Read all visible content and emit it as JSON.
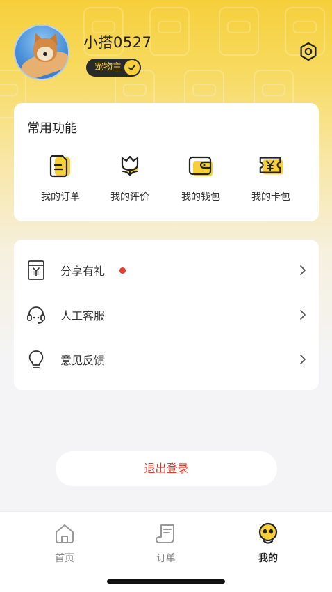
{
  "profile": {
    "username": "小搭0527",
    "badge": "宠物主"
  },
  "common_functions": {
    "title": "常用功能",
    "items": [
      {
        "label": "我的订单",
        "icon": "order-doc-icon"
      },
      {
        "label": "我的评价",
        "icon": "tulip-icon"
      },
      {
        "label": "我的钱包",
        "icon": "wallet-icon"
      },
      {
        "label": "我的卡包",
        "icon": "coupon-ticket-icon"
      }
    ]
  },
  "menu": {
    "items": [
      {
        "label": "分享有礼",
        "icon": "gift-card-icon",
        "has_dot": true
      },
      {
        "label": "人工客服",
        "icon": "headset-icon",
        "has_dot": false
      },
      {
        "label": "意见反馈",
        "icon": "lightbulb-icon",
        "has_dot": false
      }
    ]
  },
  "logout": {
    "label": "退出登录"
  },
  "tabbar": {
    "items": [
      {
        "label": "首页",
        "icon": "home-icon",
        "active": false
      },
      {
        "label": "订单",
        "icon": "receipt-icon",
        "active": false
      },
      {
        "label": "我的",
        "icon": "profile-face-icon",
        "active": true
      }
    ]
  },
  "colors": {
    "accent": "#f6cf3b",
    "logout_text": "#e0362c",
    "notification_dot": "#e83a2e"
  }
}
